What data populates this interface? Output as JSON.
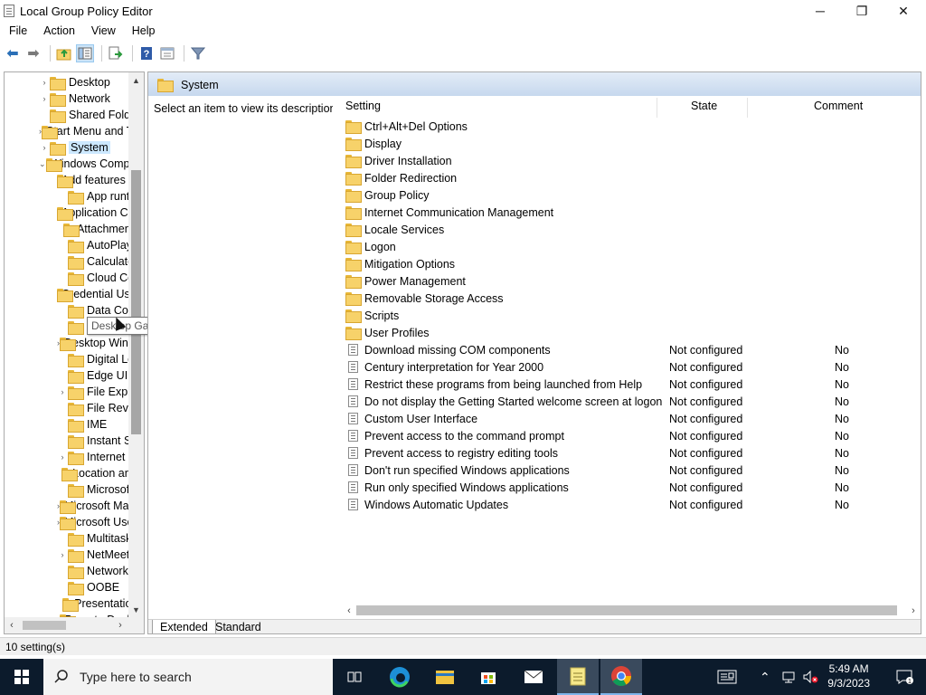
{
  "window": {
    "title": "Local Group Policy Editor",
    "minimize_glyph": "─",
    "restore_glyph": "❐",
    "close_glyph": "✕"
  },
  "menu": [
    "File",
    "Action",
    "View",
    "Help"
  ],
  "toolbar": {
    "icons": [
      "back-arrow-icon",
      "forward-arrow-icon",
      "up-folder-icon",
      "show-hide-tree-icon",
      "export-list-icon",
      "help-icon",
      "properties-icon",
      "filter-icon"
    ],
    "back_glyph": "⬅",
    "forward_glyph": "➡"
  },
  "tree": {
    "items": [
      {
        "label": "Desktop",
        "expander": "›",
        "level": 0
      },
      {
        "label": "Network",
        "expander": "›",
        "level": 0
      },
      {
        "label": "Shared Folders",
        "expander": "",
        "level": 0
      },
      {
        "label": "Start Menu and Taskbar",
        "expander": "›",
        "level": 0
      },
      {
        "label": "System",
        "expander": "›",
        "level": 0,
        "selected": true
      },
      {
        "label": "Windows Components",
        "expander": "⌄",
        "level": 0
      },
      {
        "label": "Add features to Windows",
        "expander": "",
        "level": 1
      },
      {
        "label": "App runtime",
        "expander": "",
        "level": 1
      },
      {
        "label": "Application Compatibility",
        "expander": "",
        "level": 1
      },
      {
        "label": "Attachment Manager",
        "expander": "",
        "level": 1
      },
      {
        "label": "AutoPlay Policies",
        "expander": "",
        "level": 1
      },
      {
        "label": "Calculator",
        "expander": "",
        "level": 1
      },
      {
        "label": "Cloud Content",
        "expander": "",
        "level": 1
      },
      {
        "label": "Credential User Interface",
        "expander": "",
        "level": 1
      },
      {
        "label": "Data Collection",
        "expander": "",
        "level": 1
      },
      {
        "label": "Desktop Gadgets",
        "expander": "",
        "level": 1
      },
      {
        "label": "Desktop Window Manager",
        "expander": "›",
        "level": 1
      },
      {
        "label": "Digital Locker",
        "expander": "",
        "level": 1
      },
      {
        "label": "Edge UI",
        "expander": "",
        "level": 1
      },
      {
        "label": "File Explorer",
        "expander": "›",
        "level": 1
      },
      {
        "label": "File Revocation",
        "expander": "",
        "level": 1
      },
      {
        "label": "IME",
        "expander": "",
        "level": 1
      },
      {
        "label": "Instant Search",
        "expander": "",
        "level": 1
      },
      {
        "label": "Internet Explorer",
        "expander": "›",
        "level": 1
      },
      {
        "label": "Location and Sensors",
        "expander": "",
        "level": 1
      },
      {
        "label": "Microsoft Edge",
        "expander": "",
        "level": 1
      },
      {
        "label": "Microsoft Management Console",
        "expander": "›",
        "level": 1
      },
      {
        "label": "Microsoft User Experience Virtualization",
        "expander": "›",
        "level": 1
      },
      {
        "label": "Multitasking",
        "expander": "",
        "level": 1
      },
      {
        "label": "NetMeeting",
        "expander": "›",
        "level": 1
      },
      {
        "label": "Network Sharing",
        "expander": "",
        "level": 1
      },
      {
        "label": "OOBE",
        "expander": "",
        "level": 1
      },
      {
        "label": "Presentation Settings",
        "expander": "",
        "level": 1
      },
      {
        "label": "Remote Desktop Services",
        "expander": "›",
        "level": 1
      }
    ]
  },
  "tooltip": "Desktop Gadgets",
  "right": {
    "header_title": "System",
    "description": "Select an item to view its description.",
    "columns": {
      "setting": "Setting",
      "state": "State",
      "comment": "Comment"
    },
    "items": [
      {
        "name": "Ctrl+Alt+Del Options",
        "type": "folder",
        "state": "",
        "comment": ""
      },
      {
        "name": "Display",
        "type": "folder",
        "state": "",
        "comment": ""
      },
      {
        "name": "Driver Installation",
        "type": "folder",
        "state": "",
        "comment": ""
      },
      {
        "name": "Folder Redirection",
        "type": "folder",
        "state": "",
        "comment": ""
      },
      {
        "name": "Group Policy",
        "type": "folder",
        "state": "",
        "comment": ""
      },
      {
        "name": "Internet Communication Management",
        "type": "folder",
        "state": "",
        "comment": ""
      },
      {
        "name": "Locale Services",
        "type": "folder",
        "state": "",
        "comment": ""
      },
      {
        "name": "Logon",
        "type": "folder",
        "state": "",
        "comment": ""
      },
      {
        "name": "Mitigation Options",
        "type": "folder",
        "state": "",
        "comment": ""
      },
      {
        "name": "Power Management",
        "type": "folder",
        "state": "",
        "comment": ""
      },
      {
        "name": "Removable Storage Access",
        "type": "folder",
        "state": "",
        "comment": ""
      },
      {
        "name": "Scripts",
        "type": "folder",
        "state": "",
        "comment": ""
      },
      {
        "name": "User Profiles",
        "type": "folder",
        "state": "",
        "comment": ""
      },
      {
        "name": "Download missing COM components",
        "type": "setting",
        "state": "Not configured",
        "comment": "No"
      },
      {
        "name": "Century interpretation for Year 2000",
        "type": "setting",
        "state": "Not configured",
        "comment": "No"
      },
      {
        "name": "Restrict these programs from being launched from Help",
        "type": "setting",
        "state": "Not configured",
        "comment": "No"
      },
      {
        "name": "Do not display the Getting Started welcome screen at logon",
        "type": "setting",
        "state": "Not configured",
        "comment": "No"
      },
      {
        "name": "Custom User Interface",
        "type": "setting",
        "state": "Not configured",
        "comment": "No"
      },
      {
        "name": "Prevent access to the command prompt",
        "type": "setting",
        "state": "Not configured",
        "comment": "No"
      },
      {
        "name": "Prevent access to registry editing tools",
        "type": "setting",
        "state": "Not configured",
        "comment": "No"
      },
      {
        "name": "Don't run specified Windows applications",
        "type": "setting",
        "state": "Not configured",
        "comment": "No"
      },
      {
        "name": "Run only specified Windows applications",
        "type": "setting",
        "state": "Not configured",
        "comment": "No"
      },
      {
        "name": "Windows Automatic Updates",
        "type": "setting",
        "state": "Not configured",
        "comment": "No"
      }
    ],
    "tabs": [
      "Extended",
      "Standard"
    ]
  },
  "status": "10 setting(s)",
  "taskbar": {
    "search_placeholder": "Type here to search",
    "time": "5:49 AM",
    "date": "9/3/2023",
    "apps": [
      "task-view-icon",
      "edge-icon",
      "file-explorer-icon",
      "store-icon",
      "mail-icon",
      "notepad-icon",
      "chrome-icon"
    ]
  },
  "colors": {
    "selection": "#cce8ff",
    "header_gradient_top": "#e3ecf7",
    "header_gradient_bottom": "#c6d8ee",
    "taskbar": "#0c1b2c",
    "folder": "#f7d26a"
  }
}
